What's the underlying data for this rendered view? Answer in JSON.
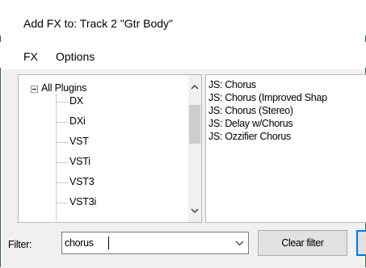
{
  "window": {
    "title": "Add FX to: Track 2 \"Gtr Body\""
  },
  "menu": {
    "items": [
      "FX",
      "Options"
    ]
  },
  "tree": {
    "root_label": "All Plugins",
    "children": [
      "DX",
      "DXi",
      "VST",
      "VSTi",
      "VST3",
      "VST3i"
    ]
  },
  "fx_list": {
    "items": [
      "JS: Chorus",
      "JS: Chorus (Improved Shap",
      "JS: Chorus (Stereo)",
      "JS: Delay w/Chorus",
      "JS: Ozzifier Chorus"
    ]
  },
  "filter": {
    "label": "Filter:",
    "value": "chorus",
    "clear_label": "Clear filter"
  },
  "colors": {
    "frame_border": "#2d6a3a",
    "focus_blue": "#0078d7"
  }
}
